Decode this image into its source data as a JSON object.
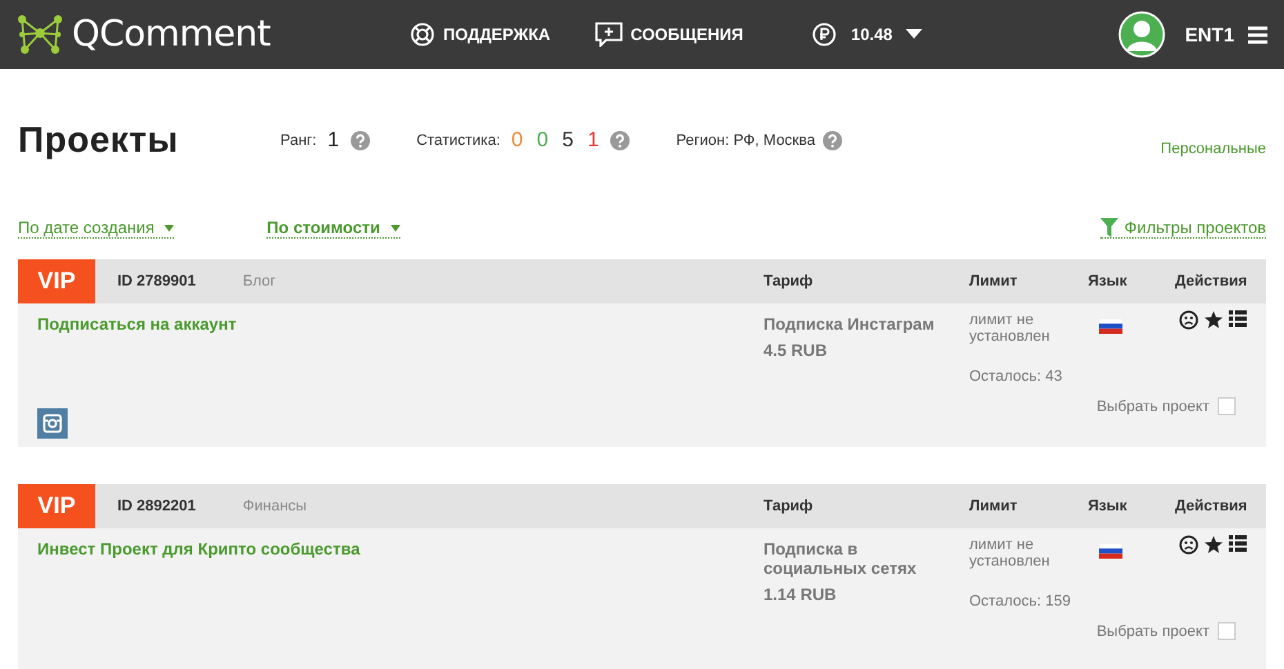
{
  "header": {
    "logo": "QComment",
    "nav": [
      {
        "label": "ПОДДЕРЖКА"
      },
      {
        "label": "СООБЩЕНИЯ"
      }
    ],
    "balance": "10.48",
    "user": "ENT1"
  },
  "page": {
    "title": "Проекты",
    "rank_label": "Ранг:",
    "rank": "1",
    "stats_label": "Статистика:",
    "stats": [
      {
        "value": "0",
        "color": "#f7882f"
      },
      {
        "value": "0",
        "color": "#4caf50"
      },
      {
        "value": "5",
        "color": "#333333"
      },
      {
        "value": "1",
        "color": "#e53935"
      }
    ],
    "region": "Регион: РФ, Москва",
    "personal_link": "Персональные"
  },
  "sort": [
    {
      "label": "По дате создания",
      "selected": false
    },
    {
      "label": "По стоимости",
      "selected": true
    }
  ],
  "filters": "Фильтры проектов",
  "projects": [
    {
      "badge": "VIP",
      "id": "ID 2789901",
      "category": "Блог",
      "columns": [
        "Тариф",
        "Лимит",
        "Язык",
        "Действия"
      ],
      "title": "Подписаться на аккаунт",
      "tariff": "Подписка Инстаграм",
      "price": "4.5 RUB",
      "limit": "лимит не установлен",
      "remaining": "Осталось: 43",
      "select_label": "Выбрать проект",
      "checked": false,
      "social": true
    },
    {
      "badge": "VIP",
      "id": "ID 2892201",
      "category": "Финансы",
      "columns": [
        "Тариф",
        "Лимит",
        "Язык",
        "Действия"
      ],
      "title": "Инвест Проект для Крипто сообщества",
      "tariff": "Подписка в социальных сетях",
      "price": "1.14 RUB",
      "limit": "лимит не установлен",
      "remaining": "Осталось: 159",
      "select_label": "Выбрать проект",
      "checked": false,
      "social": false
    }
  ]
}
